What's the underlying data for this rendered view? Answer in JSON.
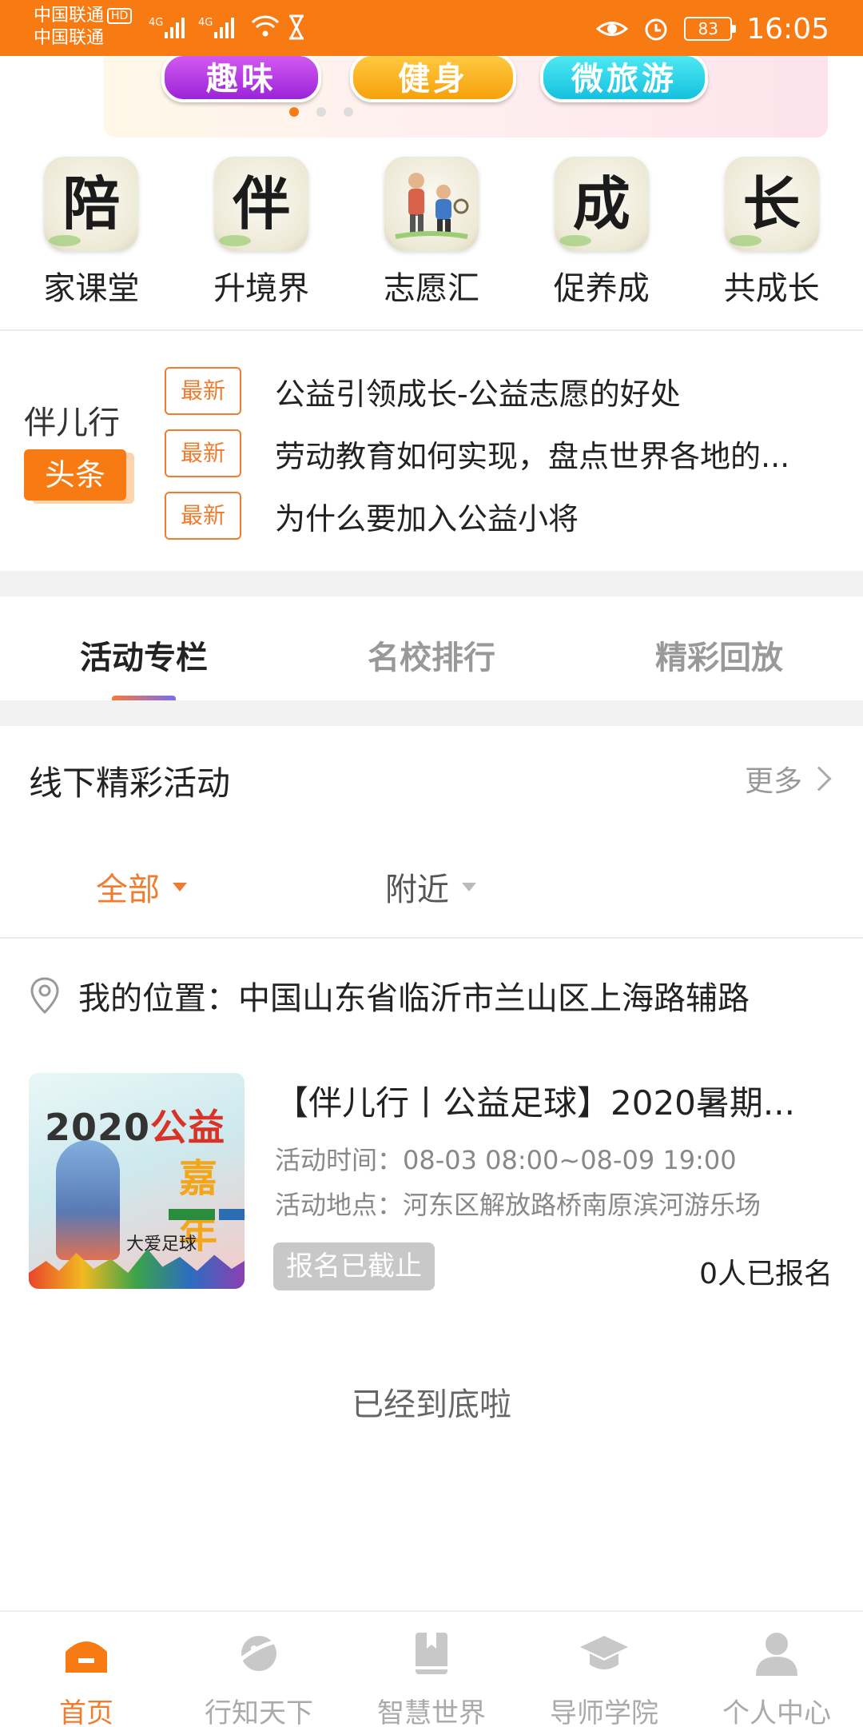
{
  "status_bar": {
    "carrier1": "中国联通",
    "hd": "HD",
    "carrier2": "中国联通",
    "battery": "83",
    "time": "16:05"
  },
  "banner": {
    "pills": [
      "趣味",
      "健身",
      "微旅游"
    ],
    "active_dot": 0,
    "dot_count": 3
  },
  "categories": [
    {
      "char": "陪",
      "label": "家课堂"
    },
    {
      "char": "伴",
      "label": "升境界"
    },
    {
      "char": "",
      "label": "志愿汇"
    },
    {
      "char": "成",
      "label": "促养成"
    },
    {
      "char": "长",
      "label": "共成长"
    }
  ],
  "headlines": {
    "brand": "伴儿行",
    "tag": "头条",
    "items": [
      {
        "badge": "最新",
        "text": "公益引领成长-公益志愿的好处"
      },
      {
        "badge": "最新",
        "text": "劳动教育如何实现，盘点世界各地的..."
      },
      {
        "badge": "最新",
        "text": "为什么要加入公益小将"
      }
    ]
  },
  "tabs": [
    {
      "label": "活动专栏",
      "active": true
    },
    {
      "label": "名校排行",
      "active": false
    },
    {
      "label": "精彩回放",
      "active": false
    }
  ],
  "section": {
    "title": "线下精彩活动",
    "more": "更多"
  },
  "filters": {
    "all": "全部",
    "nearby": "附近"
  },
  "location": {
    "text": "我的位置：中国山东省临沂市兰山区上海路辅路"
  },
  "activity": {
    "thumb_year": "2020",
    "thumb_word": "公益",
    "thumb_sub": "嘉年",
    "thumb_caption": "大爱足球",
    "title": "【伴儿行丨公益足球】2020暑期...",
    "time": "活动时间：08-03 08:00~08-09 19:00",
    "place": "活动地点：河东区解放路桥南原滨河游乐场",
    "status": "报名已截止",
    "count": "0人已报名"
  },
  "footer_note": "已经到底啦",
  "nav": [
    {
      "label": "首页",
      "icon": "home-icon",
      "active": true
    },
    {
      "label": "行知天下",
      "icon": "planet-icon",
      "active": false
    },
    {
      "label": "智慧世界",
      "icon": "book-icon",
      "active": false
    },
    {
      "label": "导师学院",
      "icon": "graduation-cap-icon",
      "active": false
    },
    {
      "label": "个人中心",
      "icon": "person-icon",
      "active": false
    }
  ],
  "colors": {
    "brand_orange": "#f87a13",
    "accent_orange": "#f07d2f"
  }
}
